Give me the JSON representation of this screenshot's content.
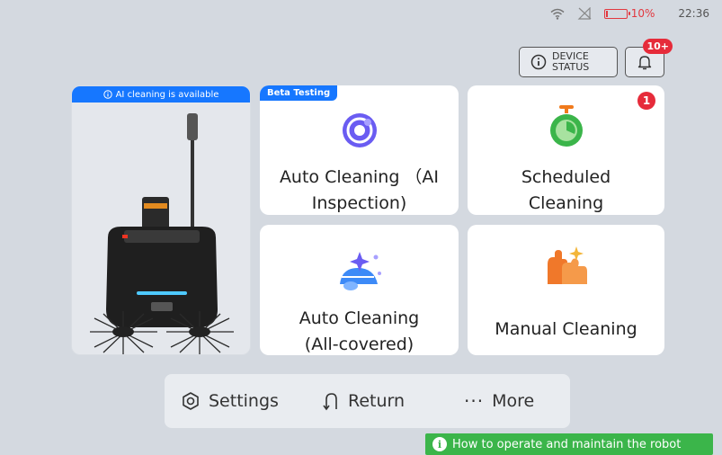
{
  "status_bar": {
    "battery_percent": "10%",
    "battery_level": 0.1,
    "time": "22:36"
  },
  "header": {
    "device_status_label": "DEVICE STATUS",
    "notification_badge": "10+"
  },
  "robot_card": {
    "banner": "AI cleaning is available"
  },
  "cards": {
    "auto_ai": {
      "tag": "Beta Testing",
      "label_line1": "Auto Cleaning （AI",
      "label_line2": "Inspection)"
    },
    "scheduled": {
      "label_line1": "Scheduled",
      "label_line2": "Cleaning",
      "badge": "1"
    },
    "auto_all": {
      "label_line1": "Auto Cleaning",
      "label_line2": "(All-covered)"
    },
    "manual": {
      "label": "Manual Cleaning"
    }
  },
  "bottom_nav": {
    "settings": "Settings",
    "return": "Return",
    "more": "More"
  },
  "help_link": "How to operate and maintain the robot",
  "colors": {
    "accent_blue": "#1677ff",
    "badge_red": "#e62b3a",
    "help_green": "#3bb54a",
    "background": "#d4d9e0"
  },
  "icons": {
    "wifi": "wifi-icon",
    "no_sim": "no-sim-icon",
    "battery": "battery-icon",
    "info": "info-icon",
    "bell": "bell-icon",
    "settings": "settings-icon",
    "return": "return-icon",
    "more": "more-icon"
  }
}
